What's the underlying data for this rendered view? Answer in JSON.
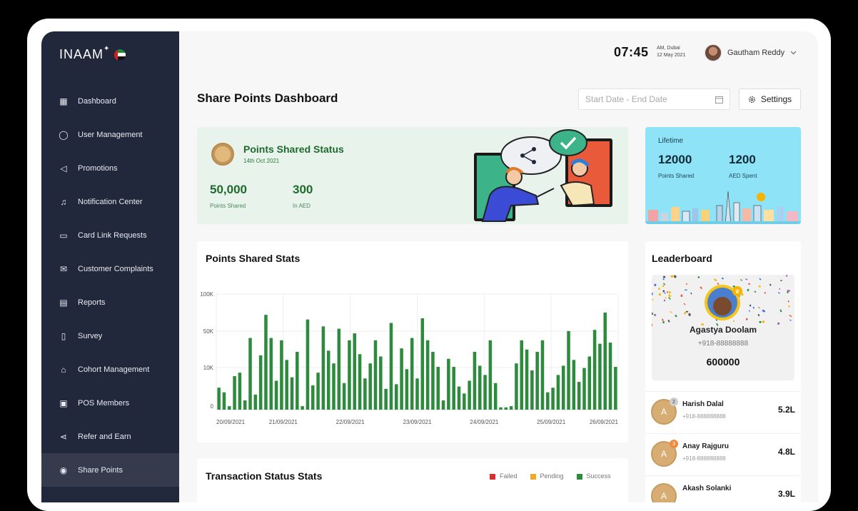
{
  "brand": {
    "name": "INAAM",
    "star": "✦"
  },
  "sidebar": {
    "items": [
      {
        "label": "Dashboard",
        "icon": "grid-icon",
        "glyph": "▦"
      },
      {
        "label": "User Management",
        "icon": "user-icon",
        "glyph": "◯"
      },
      {
        "label": "Promotions",
        "icon": "megaphone-icon",
        "glyph": "◁"
      },
      {
        "label": "Notification Center",
        "icon": "bell-icon",
        "glyph": "♫"
      },
      {
        "label": "Card Link Requests",
        "icon": "card-icon",
        "glyph": "▭"
      },
      {
        "label": "Customer Complaints",
        "icon": "mail-icon",
        "glyph": "✉"
      },
      {
        "label": "Reports",
        "icon": "document-icon",
        "glyph": "▤"
      },
      {
        "label": "Survey",
        "icon": "clipboard-icon",
        "glyph": "▯"
      },
      {
        "label": "Cohort Management",
        "icon": "hierarchy-icon",
        "glyph": "⌂"
      },
      {
        "label": "POS Members",
        "icon": "pos-icon",
        "glyph": "▣"
      },
      {
        "label": "Refer and Earn",
        "icon": "share-icon",
        "glyph": "⋖"
      },
      {
        "label": "Share Points",
        "icon": "coin-icon",
        "glyph": "◉",
        "active": true
      }
    ]
  },
  "header": {
    "time": "07:45",
    "meridiem_city": "AM, Dubai",
    "date": "12 May 2021",
    "user_name": "Gautham Reddy"
  },
  "page": {
    "title": "Share Points Dashboard",
    "date_placeholder": "Start Date - End Date",
    "settings_label": "Settings"
  },
  "status_card": {
    "title": "Points Shared Status",
    "date": "14th Oct 2021",
    "points_value": "50,000",
    "points_label": "Points Shared",
    "aed_value": "300",
    "aed_label": "In AED"
  },
  "lifetime": {
    "label": "Lifetime",
    "points_value": "12000",
    "points_label": "Points Shared",
    "aed_value": "1200",
    "aed_label": "AED Spent"
  },
  "points_chart": {
    "title": "Points Shared Stats"
  },
  "chart_data": {
    "type": "bar",
    "title": "Points Shared Stats",
    "y_tick_labels": [
      "100K",
      "50K",
      "10K",
      "0"
    ],
    "x_tick_labels": [
      "20/09/2021",
      "21/09/2021",
      "22/09/2021",
      "23/09/2021",
      "24/09/2021",
      "25/09/2021",
      "26/09/2021"
    ],
    "grid": true,
    "color": "#2e8b3e",
    "values": [
      19,
      15,
      3,
      29,
      32,
      8,
      62,
      13,
      47,
      82,
      62,
      25,
      60,
      43,
      28,
      50,
      3,
      78,
      21,
      32,
      72,
      51,
      40,
      70,
      23,
      60,
      66,
      48,
      27,
      40,
      60,
      46,
      18,
      75,
      22,
      53,
      35,
      62,
      27,
      79,
      60,
      50,
      37,
      8,
      44,
      37,
      20,
      14,
      25,
      50,
      38,
      30,
      60,
      23,
      2,
      2,
      3,
      40,
      60,
      52,
      34,
      50,
      60,
      15,
      19,
      30,
      38,
      68,
      43,
      24,
      36,
      46,
      69,
      57,
      84,
      58,
      37
    ]
  },
  "leaderboard": {
    "title": "Leaderboard",
    "top": {
      "name": "Agastya Doolam",
      "phone": "+918-88888888",
      "points": "600000"
    },
    "rows": [
      {
        "initial": "A",
        "rank": "2",
        "rank_color": "#cfcfcf",
        "name": "Harish Dalal",
        "phone": "+918-888888888",
        "points": "5.2L"
      },
      {
        "initial": "A",
        "rank": "3",
        "rank_color": "#f08a3c",
        "name": "Anay Rajguru",
        "phone": "+918-888888888",
        "points": "4.8L"
      },
      {
        "initial": "A",
        "rank": "",
        "rank_color": "transparent",
        "name": "Akash Solanki",
        "phone": "",
        "points": "3.9L"
      }
    ]
  },
  "transactions": {
    "title": "Transaction Status Stats",
    "legend": [
      {
        "label": "Failed",
        "color": "#d32f2f"
      },
      {
        "label": "Pending",
        "color": "#f5a623"
      },
      {
        "label": "Success",
        "color": "#2e8b3e"
      }
    ]
  }
}
